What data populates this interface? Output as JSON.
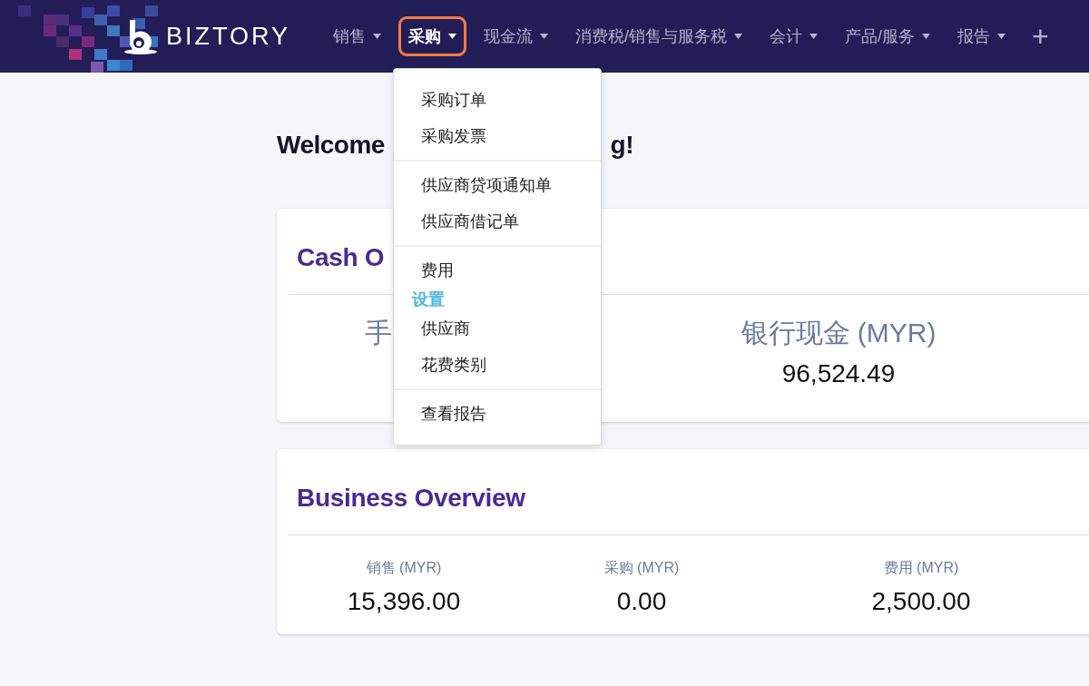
{
  "brand": "BIZTORY",
  "nav": [
    {
      "label": "销售",
      "selected": false
    },
    {
      "label": "采购",
      "selected": true
    },
    {
      "label": "现金流",
      "selected": false
    },
    {
      "label": "消费税/销售与服务税",
      "selected": false
    },
    {
      "label": "会计",
      "selected": false
    },
    {
      "label": "产品/服务",
      "selected": false
    },
    {
      "label": "报告",
      "selected": false
    }
  ],
  "nav_add": "+",
  "dropdown": [
    [
      {
        "kind": "item",
        "label": "采购订单"
      },
      {
        "kind": "item",
        "label": "采购发票"
      }
    ],
    [
      {
        "kind": "item",
        "label": "供应商贷项通知单"
      },
      {
        "kind": "item",
        "label": "供应商借记单"
      }
    ],
    [
      {
        "kind": "item",
        "label": "费用"
      },
      {
        "kind": "header",
        "label": "设置"
      },
      {
        "kind": "item",
        "label": "供应商"
      },
      {
        "kind": "item",
        "label": "花费类别"
      }
    ],
    [
      {
        "kind": "item",
        "label": "查看报告"
      }
    ]
  ],
  "welcome": {
    "left": "Welcome",
    "right": "g!"
  },
  "cash_overview": {
    "title": "Cash O",
    "column_1_label": "手",
    "bank_label": "银行现金 (MYR)",
    "bank_value": "96,524.49"
  },
  "business_overview": {
    "title": "Business Overview",
    "stats": [
      {
        "label": "销售 (MYR)",
        "value": "15,396.00"
      },
      {
        "label": "采购 (MYR)",
        "value": "0.00"
      },
      {
        "label": "费用 (MYR)",
        "value": "2,500.00"
      }
    ]
  }
}
